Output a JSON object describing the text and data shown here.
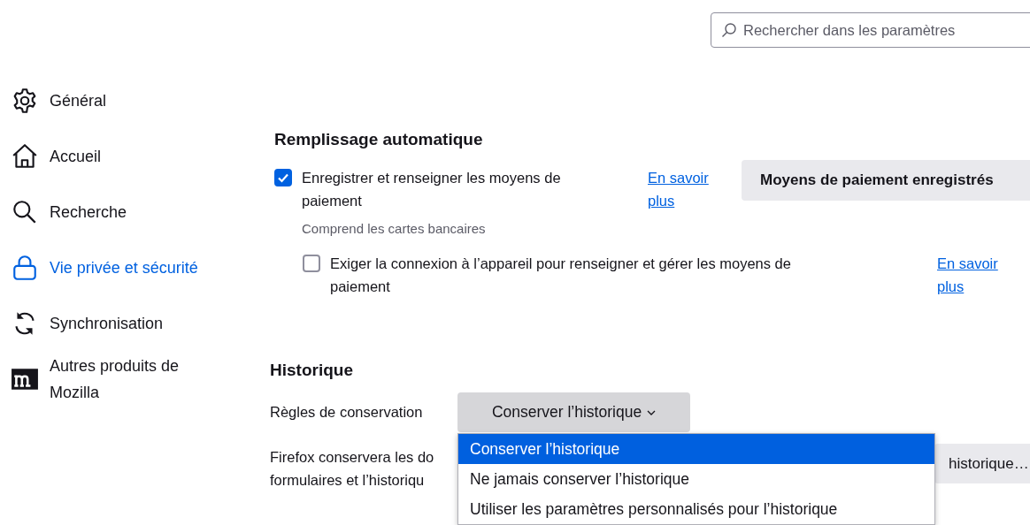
{
  "search": {
    "placeholder": "Rechercher dans les paramètres"
  },
  "sidebar": {
    "items": [
      {
        "kind": "gear",
        "label": "Général",
        "selected": false
      },
      {
        "kind": "home",
        "label": "Accueil",
        "selected": false
      },
      {
        "kind": "search",
        "label": "Recherche",
        "selected": false
      },
      {
        "kind": "lock",
        "label": "Vie privée et sécurité",
        "selected": true
      },
      {
        "kind": "sync",
        "label": "Synchronisation",
        "selected": false
      },
      {
        "kind": "logo",
        "label": "Autres produits de Mozilla",
        "selected": false
      }
    ]
  },
  "autofill": {
    "heading": "Remplissage automatique",
    "button": "Moyens de paiement enregistrés",
    "options": [
      {
        "label": "Enregistrer et renseigner les moyens de paiement",
        "checked": true,
        "link": "En savoir plus",
        "note": "Comprend les cartes bancaires"
      },
      {
        "label": "Exiger la connexion à l’appareil pour renseigner et gérer les moyens de paiement",
        "checked": false,
        "link": "En savoir plus"
      }
    ]
  },
  "history": {
    "heading": "Historique",
    "rule_label": "Règles de conservation",
    "dropdown": {
      "value": "Conserver l’historique",
      "expanded": true,
      "options": [
        {
          "label": "Conserver l’historique",
          "selected": true
        },
        {
          "label": "Ne jamais conserver l’historique",
          "selected": false
        },
        {
          "label": "Utiliser les paramètres personnalisés pour l’historique",
          "selected": false
        }
      ]
    },
    "description_lines": [
      "Firefox conservera les do",
      "formulaires et l’historiqu"
    ],
    "button": "historique…"
  }
}
